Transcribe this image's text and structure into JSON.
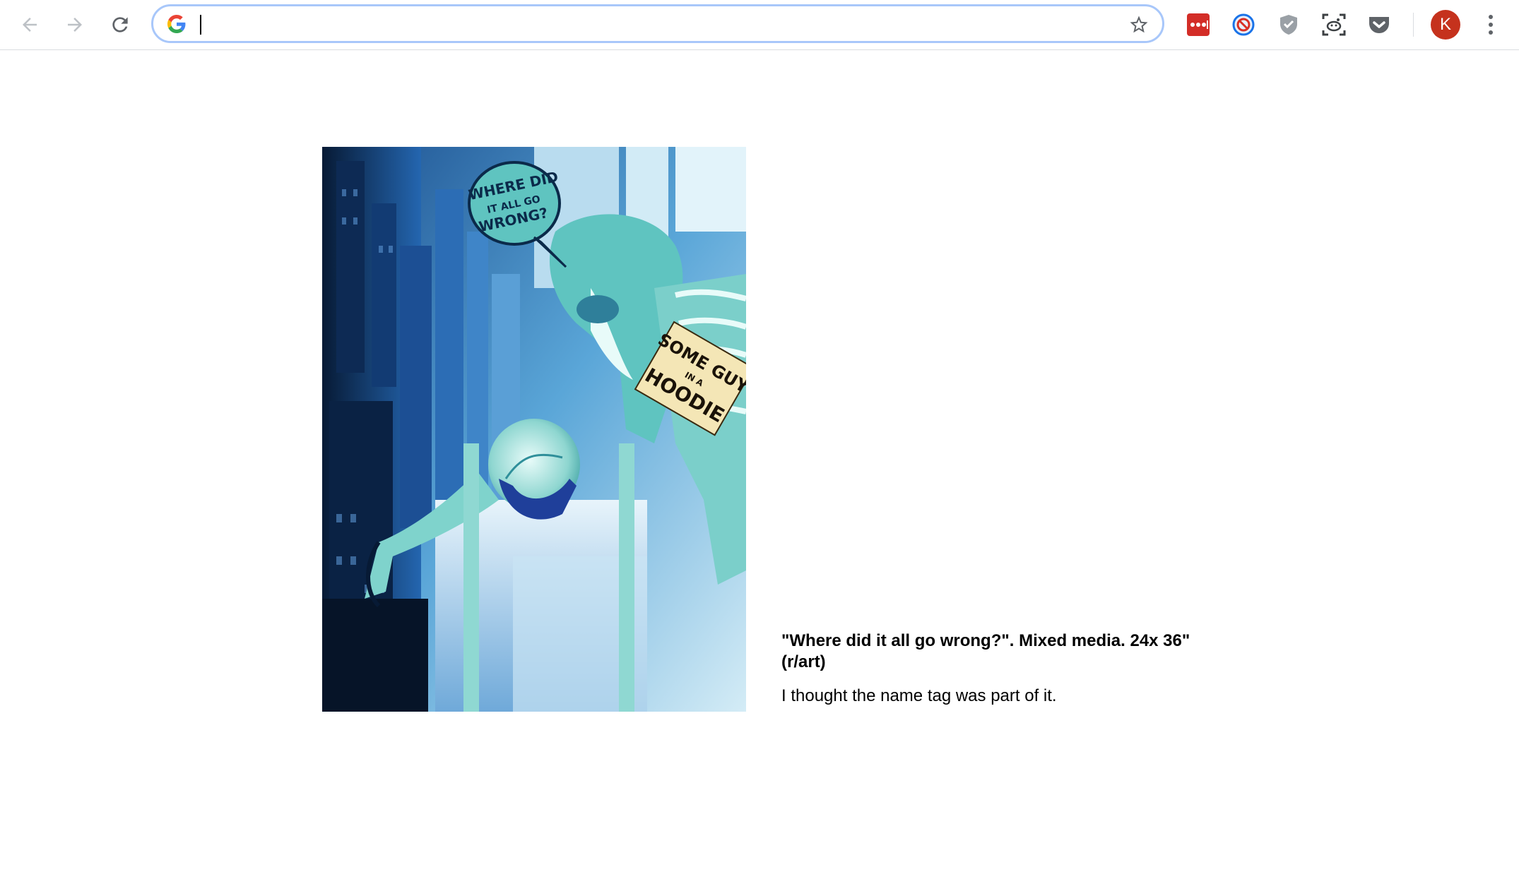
{
  "browser": {
    "back_icon": "arrow-left-icon",
    "forward_icon": "arrow-right-icon",
    "reload_icon": "reload-icon",
    "omnibox": {
      "value": "",
      "search_engine_icon": "google-g-icon",
      "bookmark_icon": "star-icon"
    },
    "extensions": [
      {
        "name": "lastpass-icon",
        "color": "#d32d27"
      },
      {
        "name": "blocked-circle-icon",
        "color": "#1a73e8"
      },
      {
        "name": "shield-check-icon",
        "color": "#9aa0a6"
      },
      {
        "name": "reddit-screenshot-icon",
        "color": "#3c4043"
      },
      {
        "name": "pocket-icon",
        "color": "#5f6368"
      }
    ],
    "profile_initial": "K",
    "profile_color": "#c5321d",
    "menu_icon": "three-dots-vertical-icon"
  },
  "page": {
    "artwork": {
      "speech_bubble_text": [
        "WHERE DID",
        "IT ALL GO",
        "WRONG?"
      ],
      "name_tag_text": [
        "SOME GUY",
        "IN A",
        "HOODIE"
      ],
      "palette": {
        "dark": "#0b1f3d",
        "mid": "#2d6cb3",
        "light": "#a8d8e8",
        "teal": "#5fc4c0"
      }
    },
    "caption": {
      "title": "\"Where did it all go wrong?\". Mixed media. 24x 36\" (r/art)",
      "comment": "I thought the name tag was part of it."
    }
  }
}
